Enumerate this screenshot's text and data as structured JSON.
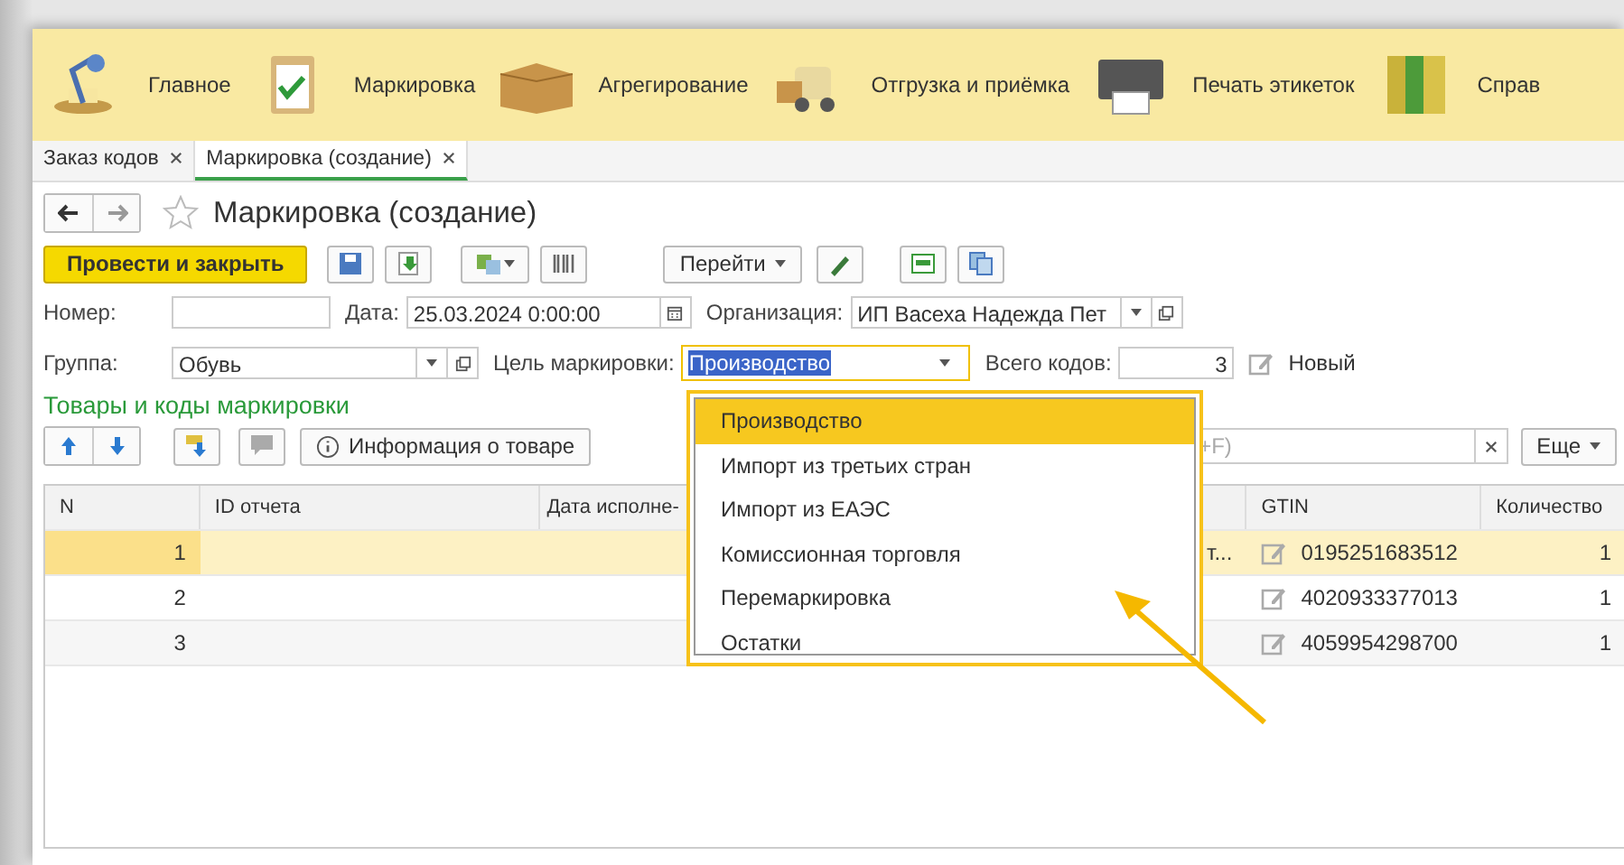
{
  "sections": [
    {
      "kind": "lamp",
      "label": "Главное"
    },
    {
      "kind": "clipboard",
      "label": "Маркировка"
    },
    {
      "kind": "box",
      "label": "Агрегирование"
    },
    {
      "kind": "truck",
      "label": "Отгрузка и приёмка"
    },
    {
      "kind": "printer",
      "label": "Печать этикеток"
    },
    {
      "kind": "binders",
      "label": "Справ"
    }
  ],
  "tabs": [
    {
      "label": "Заказ кодов",
      "selected": false
    },
    {
      "label": "Маркировка (создание)",
      "selected": true
    }
  ],
  "form": {
    "title": "Маркировка (создание)",
    "post_button": "Провести и закрыть",
    "goto_button": "Перейти",
    "number_label": "Номер:",
    "date_label": "Дата:",
    "date_value": "25.03.2024  0:00:00",
    "org_label": "Организация:",
    "org_value": "ИП Васеха Надежда Пет",
    "group_label": "Группа:",
    "group_value": "Обувь",
    "purpose_label": "Цель маркировки:",
    "purpose_value": "Производство",
    "total_label": "Всего кодов:",
    "total_value": "3",
    "status": "Новый"
  },
  "section_title": "Товары и коды маркировки",
  "info_button": "Информация о товаре",
  "search": {
    "placeholder": "+F)"
  },
  "more_button": "Еще",
  "table": {
    "columns": [
      {
        "label": "N"
      },
      {
        "label": "ID отчета"
      },
      {
        "label": "Дата исполне-"
      },
      {},
      {
        "label": "GTIN"
      },
      {
        "label": "Количество"
      }
    ],
    "rows": [
      {
        "n": "1",
        "column_4": "т...",
        "gtin": "0195251683512",
        "quantity": "1",
        "selected": true
      },
      {
        "n": "2",
        "gtin": "4020933377013",
        "quantity": "1",
        "selected": false
      },
      {
        "n": "3",
        "gtin": "4059954298700",
        "quantity": "1",
        "selected": false
      }
    ]
  },
  "dropdown": {
    "options": [
      {
        "label": "Производство",
        "selected": true
      },
      {
        "label": "Импорт из третьих стран",
        "selected": false
      },
      {
        "label": "Импорт из ЕАЭС",
        "selected": false
      },
      {
        "label": "Комиссионная торговля",
        "selected": false
      },
      {
        "label": "Перемаркировка",
        "selected": false
      },
      {
        "label": "Остатки",
        "selected": false
      }
    ]
  }
}
